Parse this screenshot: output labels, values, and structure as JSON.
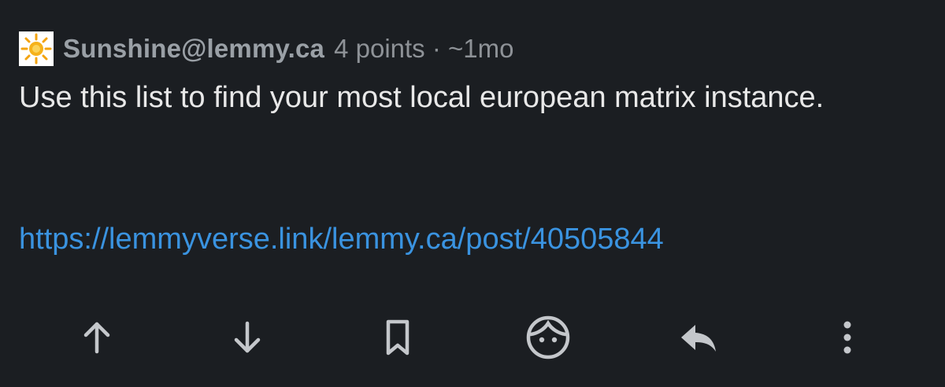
{
  "comment": {
    "avatar_icon": "sun-icon",
    "author": "Sunshine@lemmy.ca",
    "meta": "4 points · ~1mo",
    "body": "Use this list to find your most local european matrix instance.",
    "link_text": "https://lemmyverse.link/lemmy.ca/post/40505844"
  },
  "actions": [
    {
      "icon": "upvote-arrow-icon"
    },
    {
      "icon": "downvote-arrow-icon"
    },
    {
      "icon": "bookmark-icon"
    },
    {
      "icon": "face-profile-icon"
    },
    {
      "icon": "reply-icon"
    },
    {
      "icon": "more-vertical-icon"
    }
  ],
  "colors": {
    "background": "#1b1e22",
    "author": "#9aa0a6",
    "meta": "#8e9297",
    "body": "#e8e8e8",
    "link": "#3a93e0",
    "icon": "#c4c7cb"
  }
}
